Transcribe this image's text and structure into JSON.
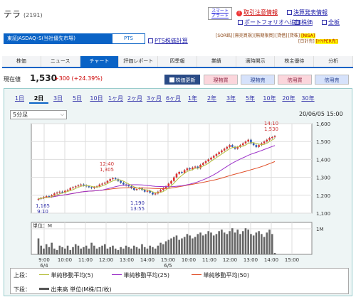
{
  "header": {
    "name": "テラ",
    "code": "(2191)"
  },
  "top_links": {
    "smart_alert": "スマート アラート",
    "caution": "取引注意情報",
    "settlement": "決算発表情報",
    "portfolio": "ポートフォリオへ追加",
    "stock_price": "株価",
    "full_board": "全板"
  },
  "market": {
    "selector": "東証JASDAQ･S(当社優先市場)",
    "pts_button": "PTS",
    "pts_link": "PTS株価計算"
  },
  "badges": [
    "[SOR銘]",
    "[無売買規]",
    "[無期限買]",
    "[貸借]",
    "[貸株]",
    "[NISA]",
    "[日計売]",
    "[HYPER売]"
  ],
  "tabs": [
    "株価",
    "ニュース",
    "チャート",
    "評価レポート",
    "四季報",
    "業績",
    "適時開示",
    "株主優待",
    "分析"
  ],
  "active_tab": "チャート",
  "quote": {
    "label": "現在値",
    "price": "1,530",
    "change": "+300 (+24.39%)"
  },
  "actions": {
    "update": "株価更新",
    "spot_buy": "現物買",
    "spot_sell": "現物売",
    "margin_buy": "信用買",
    "margin_sell": "信用売"
  },
  "range_tabs": [
    "1日",
    "2日",
    "3日",
    "5日",
    "10日",
    "1ヶ月",
    "2ヶ月",
    "3ヶ月",
    "6ヶ月",
    "1年",
    "2年",
    "3年",
    "5年",
    "10年",
    "20年",
    "30年"
  ],
  "range_selected": "2日",
  "interval": "5分足",
  "datetime": "20/06/05 15:00",
  "chart_data": {
    "type": "candlestick",
    "y_ticks": [
      "1,600",
      "1,500",
      "1,400",
      "1,300",
      "1,200",
      "1,100"
    ],
    "ylim": [
      1100,
      1600
    ],
    "x_ticks": [
      "9:00\n6/4",
      "10:00",
      "11:00",
      "12:00",
      "13:00",
      "14:00",
      "15:00\n6/5",
      "10:00",
      "11:00",
      "12:00",
      "13:00",
      "14:00",
      "15:00"
    ],
    "annotations": [
      {
        "time": "6/4 9:10",
        "value": 1165,
        "label": "1,165\n9:10"
      },
      {
        "time": "6/4 12:40",
        "value": 1305,
        "label": "12:40\n1,305"
      },
      {
        "time": "6/5 13:55",
        "value": 1190,
        "label": "1,190\n13:55"
      },
      {
        "time": "6/5 14:10",
        "value": 1530,
        "label": "14:10\n1,530"
      }
    ],
    "close": [
      1180,
      1185,
      1190,
      1195,
      1192,
      1200,
      1210,
      1215,
      1220,
      1215,
      1225,
      1230,
      1240,
      1245,
      1250,
      1255,
      1260,
      1255,
      1250,
      1245,
      1240,
      1245,
      1250,
      1260,
      1265,
      1270,
      1280,
      1290,
      1295,
      1290,
      1280,
      1270,
      1260,
      1255,
      1250,
      1240,
      1230,
      1235,
      1240,
      1230,
      1220,
      1225,
      1215,
      1205,
      1210,
      1220,
      1230,
      1240,
      1250,
      1265,
      1280,
      1300,
      1320,
      1330,
      1325,
      1340,
      1350,
      1345,
      1355,
      1360,
      1350,
      1370,
      1380,
      1390,
      1400,
      1410,
      1420,
      1430,
      1440,
      1450,
      1460,
      1470,
      1480,
      1470,
      1460,
      1470,
      1480,
      1490,
      1500,
      1510,
      1490,
      1480,
      1470,
      1480,
      1490,
      1500,
      1510,
      1520,
      1525,
      1530
    ],
    "ma_colors": {
      "ma5": "#b8c040",
      "ma25": "#9b30c8",
      "ma50": "#e0502a"
    },
    "volume_label": "単位：M",
    "volume_tick": "1M",
    "volume": [
      0.55,
      0.3,
      0.2,
      0.35,
      0.25,
      0.4,
      0.2,
      0.15,
      0.3,
      0.25,
      0.2,
      0.3,
      0.15,
      0.25,
      0.35,
      0.3,
      0.2,
      0.25,
      0.3,
      0.2,
      0.4,
      0.3,
      0.2,
      0.25,
      0.3,
      0.35,
      0.2,
      0.25,
      0.3,
      0.2,
      0.15,
      0.25,
      0.2,
      0.3,
      0.25,
      0.2,
      0.3,
      0.25,
      0.2,
      0.35,
      0.25,
      0.2,
      0.3,
      0.25,
      0.2,
      0.3,
      0.4,
      0.35,
      0.45,
      0.5,
      0.55,
      0.6,
      0.65,
      0.5,
      0.55,
      0.6,
      0.7,
      0.65,
      0.55,
      0.6,
      0.7,
      0.75,
      0.65,
      0.7,
      0.8,
      0.75,
      0.65,
      0.7,
      0.8,
      0.85,
      0.75,
      0.7,
      0.8,
      0.9,
      0.75,
      0.85,
      0.7,
      0.8,
      0.9,
      0.85,
      0.7,
      0.65,
      0.75,
      0.8,
      0.7,
      0.6,
      0.75,
      0.85,
      0.7,
      0.05
    ]
  },
  "legend": {
    "upper_label": "上段：",
    "ma5": "単純移動平均(5)",
    "ma25": "単純移動平均(25)",
    "ma50": "単純移動平均(50)",
    "lower_label": "下段：",
    "volume": "出来高 単位(M株/口/枚)"
  }
}
